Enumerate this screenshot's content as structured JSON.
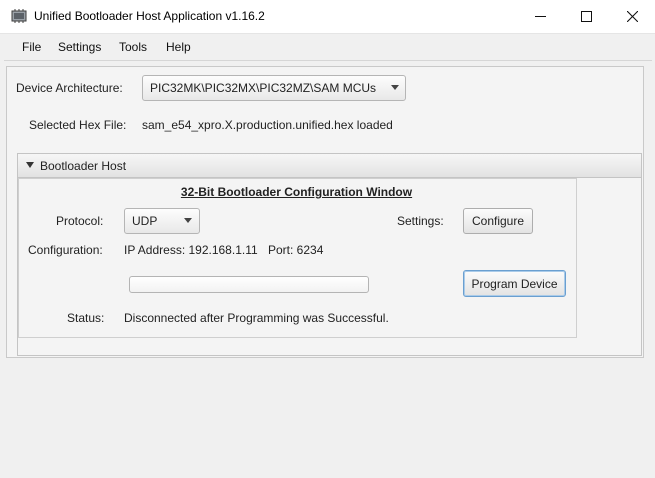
{
  "window": {
    "title": "Unified Bootloader Host Application v1.16.2",
    "icon": "chip-icon",
    "controls": [
      "minimize-icon",
      "maximize-icon",
      "close-icon"
    ]
  },
  "menu": [
    "File",
    "Settings",
    "Tools",
    "Help"
  ],
  "device": {
    "label": "Device Architecture:",
    "selected": "PIC32MK\\PIC32MX\\PIC32MZ\\SAM MCUs"
  },
  "hex": {
    "label": "Selected Hex File:",
    "value": "sam_e54_xpro.X.production.unified.hex loaded"
  },
  "section": {
    "title": "Bootloader Host",
    "heading": "32-Bit Bootloader Configuration Window"
  },
  "protocol": {
    "label": "Protocol:",
    "selected": "UDP"
  },
  "settings": {
    "label": "Settings:",
    "button": "Configure"
  },
  "configuration": {
    "label": "Configuration:",
    "ip": "IP Address: 192.168.1.11",
    "port": "Port: 6234"
  },
  "progress": {
    "value": 0
  },
  "program_button": "Program Device",
  "status": {
    "label": "Status:",
    "value": "Disconnected after Programming was Successful."
  },
  "colors": {
    "progress_fill": "#3a8fd6",
    "focus_border": "#6a9fd0"
  }
}
